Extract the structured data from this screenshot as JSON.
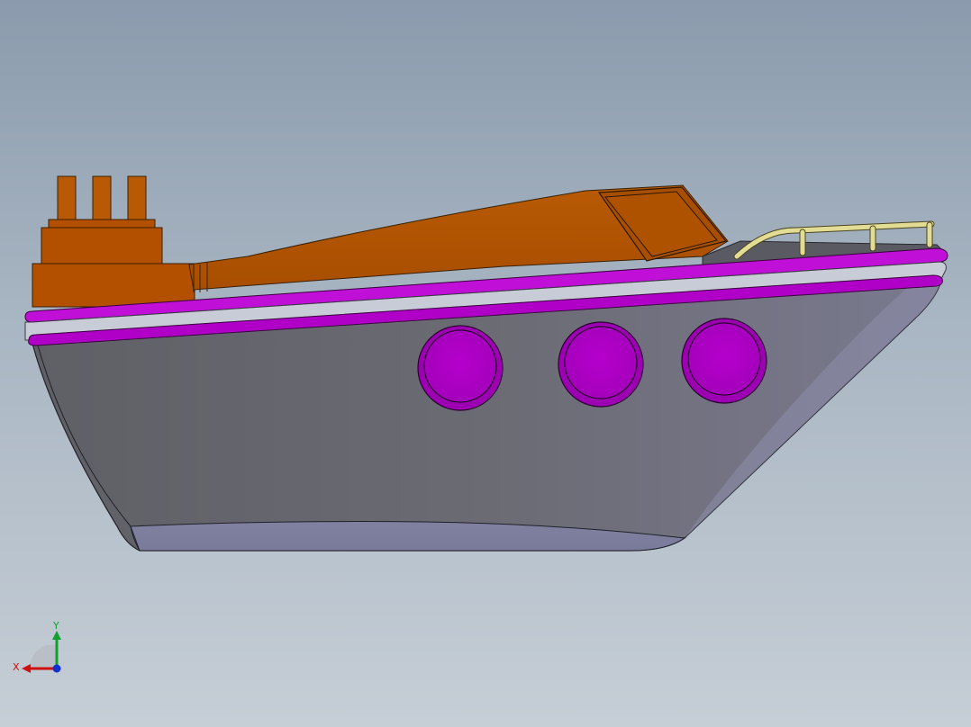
{
  "viewport": {
    "background_top": "#8b9bad",
    "background_bottom": "#c6ced6"
  },
  "model": {
    "hull_color": "#6e6f7c",
    "trim_color": "#b000c8",
    "superstructure_color": "#b25000",
    "railing_color": "#e2dc94"
  },
  "triad": {
    "x_label": "X",
    "y_label": "Y",
    "x_color": "#d01010",
    "y_color": "#10a030",
    "z_color": "#1030d0"
  }
}
